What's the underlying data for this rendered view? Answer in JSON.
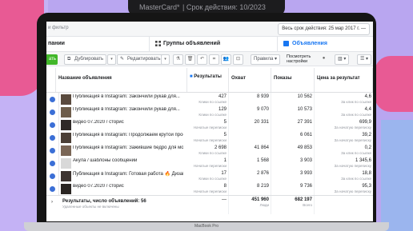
{
  "backdrop": {
    "phone_card": "MasterCard*",
    "phone_expiry": "| Срок действия: 10/2023",
    "laptop_brand": "MacBook Pro"
  },
  "header": {
    "search_placeholder": "и фильтр",
    "date_range": "Весь срок действия: 25 мар 2017 г. —"
  },
  "tabs": [
    {
      "label": "пании"
    },
    {
      "label": "Группы объявлений"
    },
    {
      "label": "Объявления"
    }
  ],
  "toolbar": {
    "create": "ать",
    "duplicate": "Дублировать",
    "edit": "Редактировать",
    "rules": "Правила",
    "view_setup_line1": "Посмотреть",
    "view_setup_line2": "настройки"
  },
  "table": {
    "columns": [
      {
        "label": "Название объявления",
        "sub": ""
      },
      {
        "label": "Результаты",
        "sub": ""
      },
      {
        "label": "Охват",
        "sub": ""
      },
      {
        "label": "Показы",
        "sub": ""
      },
      {
        "label": "Цена за результат",
        "sub": ""
      }
    ],
    "rows": [
      {
        "name": "Публикация в Instagram: Закончили рукав для...",
        "results": "427",
        "results_sub": "Клики по ссылке",
        "reach": "8 939",
        "impressions": "10 562",
        "cost": "4,6",
        "cost_sub": "За клик по ссылке"
      },
      {
        "name": "Публикация в Instagram: Закончили рукав для...",
        "results": "129",
        "results_sub": "Клики по ссылке",
        "reach": "9 070",
        "impressions": "10 573",
        "cost": "4,4",
        "cost_sub": "За клик по ссылке"
      },
      {
        "name": "видео 07.2020 / сторис",
        "results": "5",
        "results_sub": "Начатые переписки",
        "reach": "20 331",
        "impressions": "27 391",
        "cost": "699,9",
        "cost_sub": "За начатую переписку"
      },
      {
        "name": "Публикация в Instagram: Продолжаем крутой проект...",
        "results": "5",
        "results_sub": "Начатые переписки",
        "reach": "",
        "impressions": "6 061",
        "cost": "39,2",
        "cost_sub": "За начатую переписку"
      },
      {
        "name": "Публикация в Instagram: Зажившие бедро для моей...",
        "results": "2 698",
        "results_sub": "Клики по ссылке",
        "reach": "41 864",
        "impressions": "49 853",
        "cost": "0,2",
        "cost_sub": "За клик по ссылке"
      },
      {
        "name": "Акула / шаблоны сообщений",
        "results": "1",
        "results_sub": "Начатые переписки",
        "reach": "1 568",
        "impressions": "3 903",
        "cost": "1 345,6",
        "cost_sub": "За начатую переписку"
      },
      {
        "name": "Публикация в Instagram: Готовая работа 🔥 Дизайн...",
        "results": "17",
        "results_sub": "Клики по ссылке",
        "reach": "2 876",
        "impressions": "3 993",
        "cost": "18,8",
        "cost_sub": "За клик по ссылке"
      },
      {
        "name": "видео 07.2020 / сторис",
        "results": "8",
        "results_sub": "Начатые переписки",
        "reach": "8 219",
        "impressions": "9 736",
        "cost": "95,3",
        "cost_sub": "За начатую переписку"
      }
    ],
    "total": {
      "title": "Результаты, число объявлений: 56",
      "sub": "Удаленные объекты не включены",
      "results": "—",
      "reach": "451 960",
      "reach_sub": "Люди",
      "impressions": "682 197",
      "impressions_sub": "Всего"
    }
  },
  "colors": {
    "accent": "#1877f2",
    "create_green": "#42b72a",
    "row_check": "#3b6fd6"
  }
}
